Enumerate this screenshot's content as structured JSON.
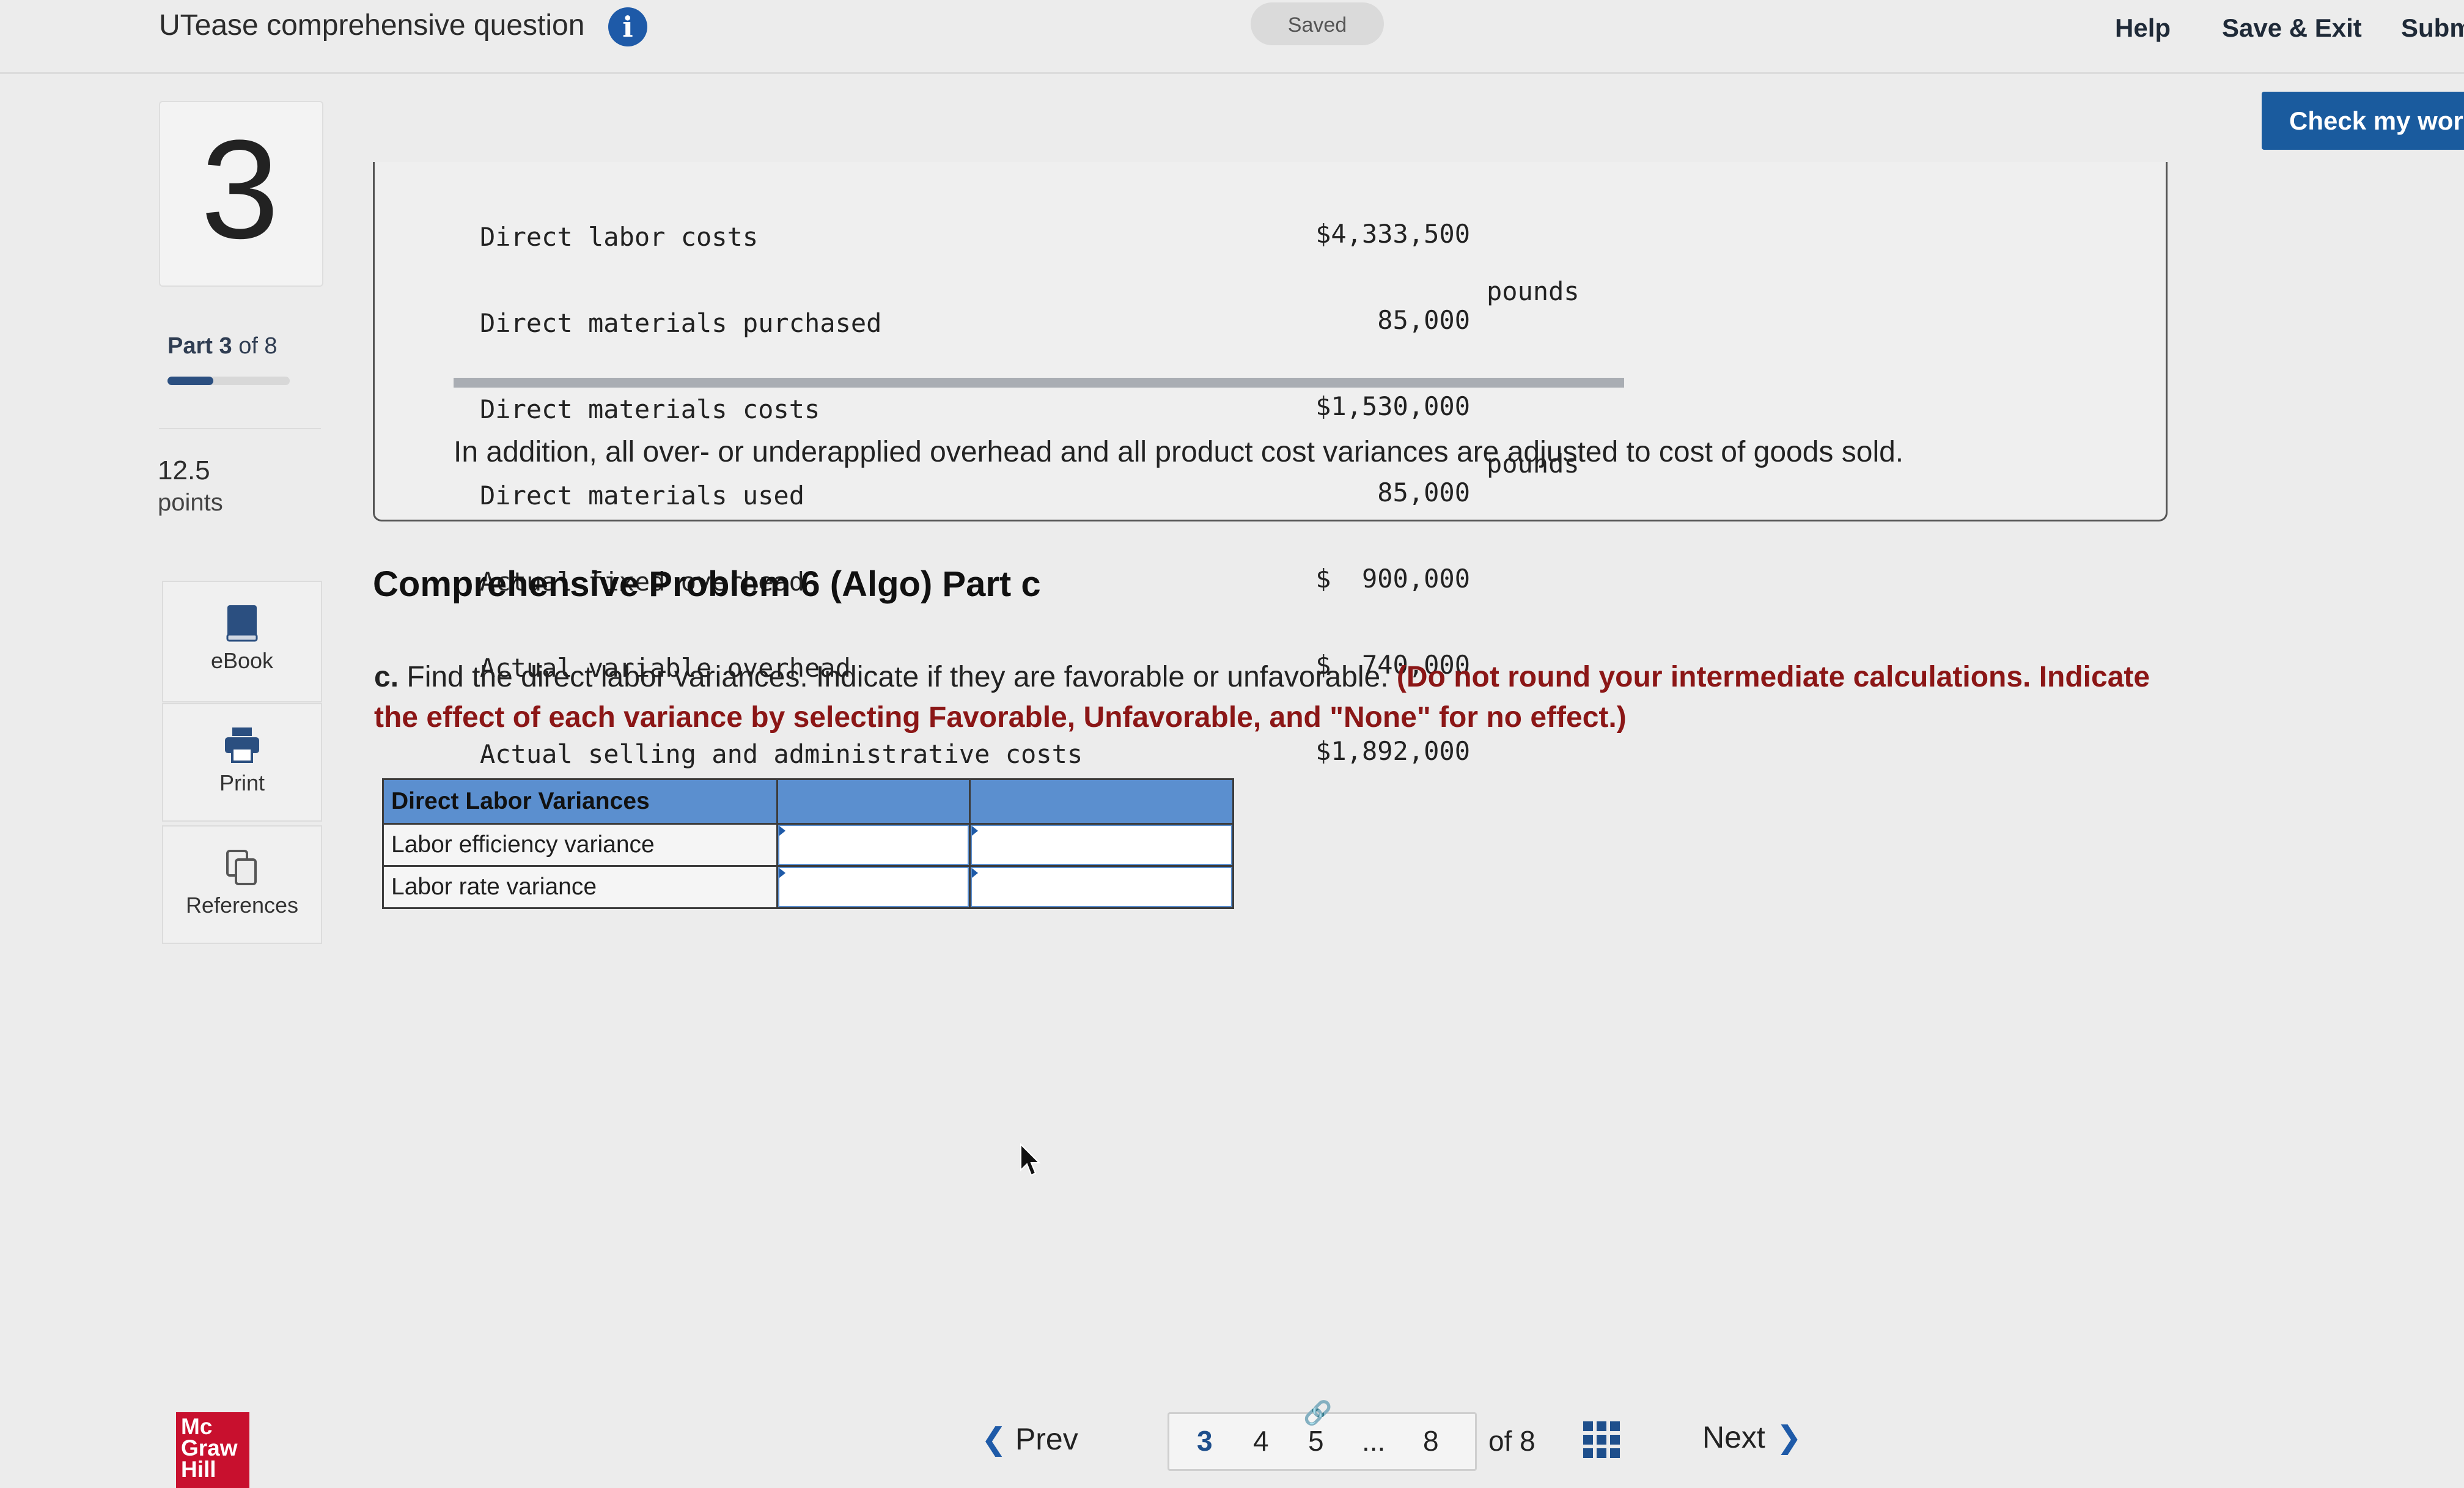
{
  "header": {
    "title": "UTease comprehensive question",
    "saved": "Saved",
    "help": "Help",
    "save_exit": "Save & Exit",
    "submit": "Subm",
    "check_my_work": "Check my work"
  },
  "rail": {
    "question_number": "3",
    "part_prefix": "Part",
    "part_current": "3",
    "part_suffix": "of 8",
    "part_progress_fraction": 0.375,
    "points_value": "12.5",
    "points_label": "points",
    "tools": [
      {
        "label": "eBook",
        "icon": "book-icon"
      },
      {
        "label": "Print",
        "icon": "printer-icon"
      },
      {
        "label": "References",
        "icon": "copy-icon"
      }
    ]
  },
  "data_table": {
    "rows": [
      {
        "label": "Direct labor costs",
        "value": "$4,333,500",
        "unit": ""
      },
      {
        "label": "Direct materials purchased",
        "value": "85,000",
        "unit": "pounds"
      },
      {
        "label": "Direct materials costs",
        "value": "$1,530,000",
        "unit": ""
      },
      {
        "label": "Direct materials used",
        "value": "85,000",
        "unit": "pounds"
      },
      {
        "label": "Actual fixed overhead",
        "value": "$  900,000",
        "unit": ""
      },
      {
        "label": "Actual variable overhead",
        "value": "$  740,000",
        "unit": ""
      },
      {
        "label": "Actual selling and administrative costs",
        "value": "$1,892,000",
        "unit": ""
      }
    ],
    "note": "In addition, all over- or underapplied overhead and all product cost variances are adjusted to cost of goods sold."
  },
  "problem": {
    "title": "Comprehensive Problem 6 (Algo) Part c",
    "instruction_lead": "c.",
    "instruction_text": " Find the direct labor variances. Indicate if they are favorable or unfavorable. ",
    "instruction_note": "(Do not round your intermediate calculations. Indicate the effect of each variance by selecting Favorable, Unfavorable, and \"None\" for no effect.)"
  },
  "answer_table": {
    "header": "Direct Labor Variances",
    "rows": [
      {
        "label": "Labor efficiency variance",
        "amount": "",
        "effect": ""
      },
      {
        "label": "Labor rate variance",
        "amount": "",
        "effect": ""
      }
    ]
  },
  "footer": {
    "logo_lines": [
      "Mc",
      "Graw",
      "Hill"
    ],
    "prev": "Prev",
    "pages": [
      "3",
      "4",
      "5",
      "...",
      "8"
    ],
    "of_total": "of 8",
    "next": "Next"
  },
  "colors": {
    "accent_blue": "#1e5aa8",
    "table_header_blue": "#5b8fcf",
    "instruction_red": "#8b1616",
    "logo_red": "#c8102e"
  }
}
